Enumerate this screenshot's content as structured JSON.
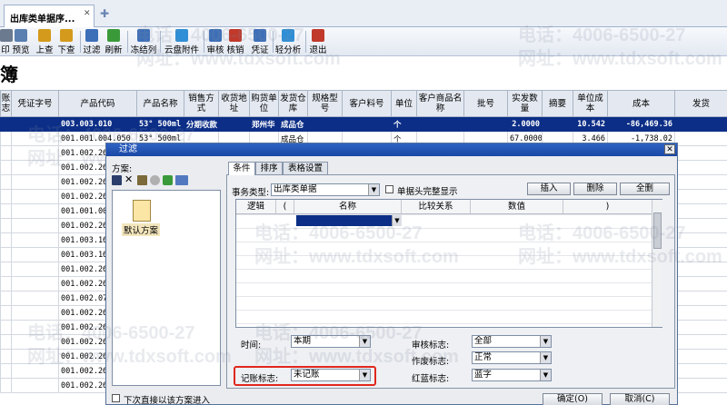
{
  "tab": {
    "title": "出库类单据序...",
    "close": "✕",
    "add": "✚"
  },
  "toolbar": [
    {
      "label": "印",
      "icon": "print-icon",
      "color": "#6c7a8f"
    },
    {
      "label": "预览",
      "icon": "preview-icon",
      "color": "#5a7fb0"
    },
    {
      "label": "上查",
      "icon": "up-query-icon",
      "color": "#d49a1c"
    },
    {
      "label": "下查",
      "icon": "down-query-icon",
      "color": "#d49a1c"
    },
    {
      "label": "过滤",
      "icon": "filter-icon",
      "color": "#3d6fb8"
    },
    {
      "label": "刷新",
      "icon": "refresh-icon",
      "color": "#3a9a3a"
    },
    {
      "label": "冻结列",
      "icon": "freeze-icon",
      "color": "#3d6fb8"
    },
    {
      "label": "云盘附件",
      "icon": "cloud-attach-icon",
      "color": "#2f8fd6"
    },
    {
      "label": "审核",
      "icon": "audit-icon",
      "color": "#3d6fb8"
    },
    {
      "label": "核销",
      "icon": "verify-icon",
      "color": "#c0392b"
    },
    {
      "label": "凭证",
      "icon": "voucher-icon",
      "color": "#3d6fb8"
    },
    {
      "label": "轻分析",
      "icon": "analysis-icon",
      "color": "#2f8fd6"
    },
    {
      "label": "退出",
      "icon": "exit-icon",
      "color": "#c0392b"
    }
  ],
  "page_title": "簿",
  "grid": {
    "headers": [
      "账\n志",
      "凭证字号",
      "产品代码",
      "产品名称",
      "销售方\n式",
      "收货地\n址",
      "购货单\n位",
      "发货仓\n库",
      "规格型\n号",
      "客户料号",
      "单位",
      "客户商品名\n称",
      "批号",
      "实发数\n量",
      "摘要",
      "单位成\n本",
      "成本",
      "发货"
    ],
    "selected_row": [
      "",
      "",
      "003.003.010",
      "53° 500ml",
      "分期收款",
      "",
      "郑州华",
      "成品仓",
      "",
      "",
      "个",
      "",
      "",
      "2.0000",
      "",
      "10.542",
      "-86,469.36",
      ""
    ],
    "rows": [
      [
        "",
        "",
        "001.001.004.050",
        "53° 500ml",
        "",
        "",
        "",
        "成品仓",
        "",
        "",
        "个",
        "",
        "",
        "67.0000",
        "",
        "3.466",
        "-1,738.02",
        ""
      ],
      [
        "",
        "",
        "001.002.266",
        "",
        "",
        "",
        "",
        "",
        "",
        "",
        "",
        "",
        "",
        "",
        "",
        "",
        "",
        ""
      ],
      [
        "",
        "",
        "001.002.266",
        "",
        "",
        "",
        "",
        "",
        "",
        "",
        "",
        "",
        "",
        "",
        "",
        "",
        "",
        ""
      ],
      [
        "",
        "",
        "001.002.265",
        "",
        "",
        "",
        "",
        "",
        "",
        "",
        "",
        "",
        "",
        "",
        "",
        "",
        "",
        ""
      ],
      [
        "",
        "",
        "001.002.266",
        "",
        "",
        "",
        "",
        "",
        "",
        "",
        "",
        "",
        "",
        "",
        "",
        "",
        "",
        ""
      ],
      [
        "",
        "",
        "001.001.004",
        "",
        "",
        "",
        "",
        "",
        "",
        "",
        "",
        "",
        "",
        "",
        "",
        "",
        "",
        ""
      ],
      [
        "",
        "",
        "001.002.266",
        "",
        "",
        "",
        "",
        "",
        "",
        "",
        "",
        "",
        "",
        "",
        "",
        "",
        "",
        ""
      ],
      [
        "",
        "",
        "001.003.165",
        "",
        "",
        "",
        "",
        "",
        "",
        "",
        "",
        "",
        "",
        "",
        "",
        "",
        "",
        ""
      ],
      [
        "",
        "",
        "001.003.165",
        "",
        "",
        "",
        "",
        "",
        "",
        "",
        "",
        "",
        "",
        "",
        "",
        "",
        "",
        ""
      ],
      [
        "",
        "",
        "001.002.266",
        "",
        "",
        "",
        "",
        "",
        "",
        "",
        "",
        "",
        "",
        "",
        "",
        "",
        "",
        ""
      ],
      [
        "",
        "",
        "001.002.266",
        "",
        "",
        "",
        "",
        "",
        "",
        "",
        "",
        "",
        "",
        "",
        "",
        "",
        "",
        ""
      ],
      [
        "",
        "",
        "001.002.071",
        "",
        "",
        "",
        "",
        "",
        "",
        "",
        "",
        "",
        "",
        "",
        "",
        "",
        "",
        ""
      ],
      [
        "",
        "",
        "001.002.266",
        "",
        "",
        "",
        "",
        "",
        "",
        "",
        "",
        "",
        "",
        "",
        "",
        "",
        "",
        ""
      ],
      [
        "",
        "",
        "001.002.266",
        "",
        "",
        "",
        "",
        "",
        "",
        "",
        "",
        "",
        "",
        "",
        "",
        "",
        "",
        ""
      ],
      [
        "",
        "",
        "001.002.265",
        "",
        "",
        "",
        "",
        "",
        "",
        "",
        "",
        "",
        "",
        "",
        "",
        "",
        "",
        ""
      ],
      [
        "",
        "",
        "001.002.265",
        "",
        "",
        "",
        "",
        "",
        "",
        "",
        "",
        "",
        "",
        "",
        "",
        "",
        "",
        ""
      ],
      [
        "",
        "",
        "001.002.266",
        "",
        "",
        "",
        "",
        "",
        "",
        "",
        "",
        "",
        "",
        "",
        "",
        "",
        "",
        ""
      ],
      [
        "",
        "",
        "001.002.266",
        "",
        "",
        "",
        "",
        "",
        "",
        "",
        "",
        "",
        "",
        "",
        "",
        "",
        "",
        ""
      ]
    ]
  },
  "dialog": {
    "title": "过滤",
    "close": "✕",
    "scheme_label": "方案:",
    "default_scheme": "默认方案",
    "tabs": [
      "条件",
      "排序",
      "表格设置"
    ],
    "biz_type_label": "事务类型:",
    "biz_type_value": "出库类单据",
    "complete_display_label": "单据头完整显示",
    "insert_btn": "插入",
    "delete_btn": "删除",
    "clear_btn": "全删",
    "cond_headers": [
      "逻辑",
      "(",
      "名称",
      "比较关系",
      "数值",
      ")"
    ],
    "time_label": "时间:",
    "time_value": "本期",
    "audit_label": "审核标志:",
    "audit_value": "全部",
    "void_label": "作废标志:",
    "void_value": "正常",
    "post_label": "记账标志:",
    "post_value": "未记账",
    "redblue_label": "红蓝标志:",
    "redblue_value": "蓝字",
    "direct_enter_label": "下次直接以该方案进入",
    "ok_btn": "确定(O)",
    "cancel_btn": "取消(C)"
  },
  "watermarks": [
    "电话：4006-6500-27",
    "网址：www.tdxsoft.com"
  ]
}
